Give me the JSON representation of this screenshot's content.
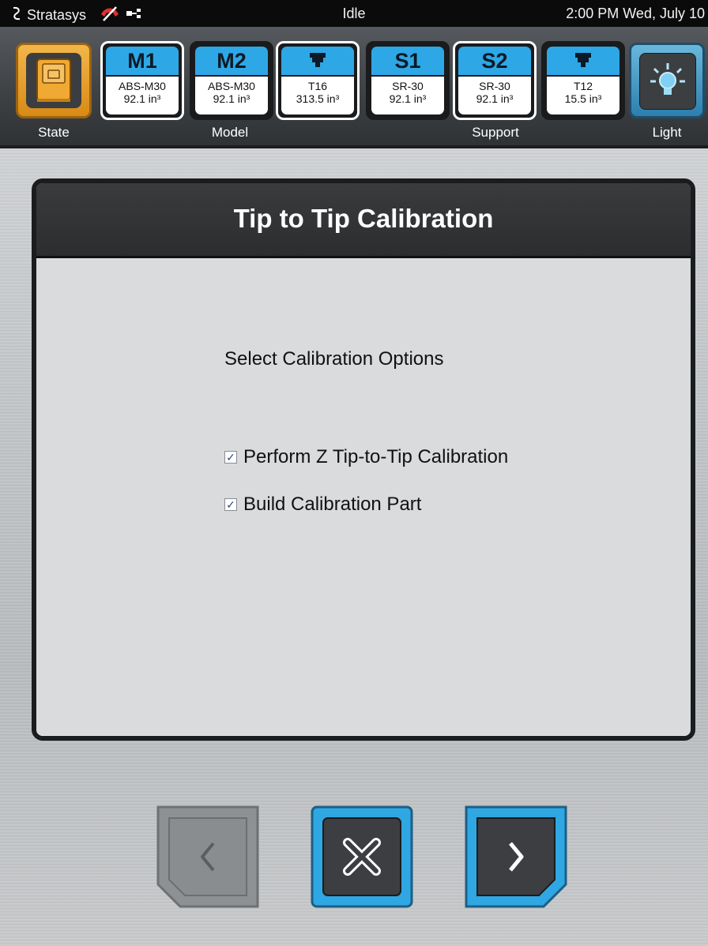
{
  "status_bar": {
    "brand": "Stratasys",
    "status": "Idle",
    "datetime": "2:00 PM Wed, July 10"
  },
  "toolbar": {
    "state_label": "State",
    "model_label": "Model",
    "support_label": "Support",
    "light_label": "Light",
    "materials": [
      {
        "head": "M1",
        "name": "ABS-M30",
        "amount": "92.1 in³",
        "selected": true
      },
      {
        "head": "M2",
        "name": "ABS-M30",
        "amount": "92.1 in³",
        "selected": false
      },
      {
        "head": "",
        "name": "T16",
        "amount": "313.5 in³",
        "selected": true
      },
      {
        "head": "S1",
        "name": "SR-30",
        "amount": "92.1 in³",
        "selected": false
      },
      {
        "head": "S2",
        "name": "SR-30",
        "amount": "92.1 in³",
        "selected": true
      },
      {
        "head": "",
        "name": "T12",
        "amount": "15.5 in³",
        "selected": false
      }
    ]
  },
  "dialog": {
    "title": "Tip to Tip Calibration",
    "prompt": "Select Calibration Options",
    "options": [
      {
        "label": "Perform Z Tip-to-Tip Calibration",
        "checked": true
      },
      {
        "label": "Build Calibration Part",
        "checked": true
      }
    ]
  },
  "colors": {
    "accent_blue": "#2ea7e6",
    "state_orange": "#e9a02a",
    "dialog_header": "#333436"
  },
  "icons": [
    "back-icon",
    "cancel-icon",
    "next-icon",
    "light-bulb-icon",
    "printer-icon",
    "tip-icon"
  ]
}
